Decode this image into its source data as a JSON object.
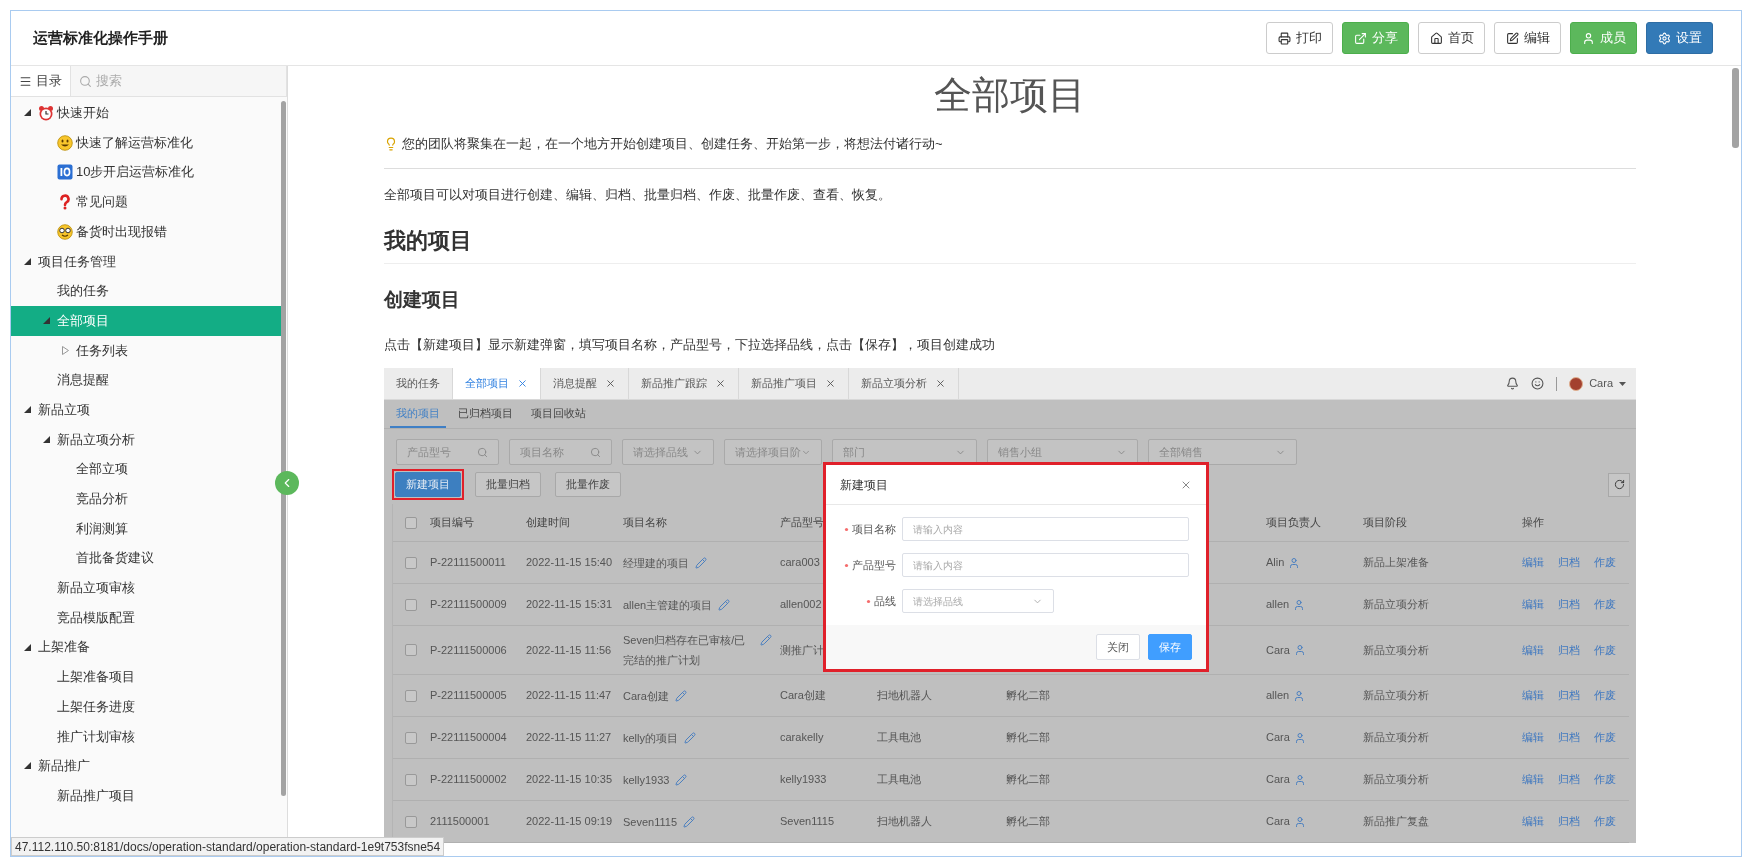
{
  "header": {
    "title": "运营标准化操作手册",
    "buttons": [
      {
        "label": "打印",
        "kind": "default"
      },
      {
        "label": "分享",
        "kind": "success"
      },
      {
        "label": "首页",
        "kind": "default"
      },
      {
        "label": "编辑",
        "kind": "default"
      },
      {
        "label": "成员",
        "kind": "success"
      },
      {
        "label": "设置",
        "kind": "primary"
      }
    ]
  },
  "sidebar": {
    "tabs": [
      {
        "label": "目录",
        "selected": true
      },
      {
        "label": "搜索",
        "selected": false
      }
    ],
    "items": [
      {
        "label": "快速开始",
        "expanded": true,
        "selected": false,
        "children": [
          {
            "label": "快速了解运营标准化",
            "selected": false
          },
          {
            "label": "10步开启运营标准化",
            "selected": false
          },
          {
            "label": "常见问题",
            "selected": false
          },
          {
            "label": "备货时出现报错",
            "selected": false
          }
        ]
      },
      {
        "label": "项目任务管理",
        "expanded": true,
        "selected": false,
        "children": [
          {
            "label": "我的任务",
            "selected": false
          },
          {
            "label": "全部项目",
            "expanded": true,
            "selected": true,
            "children": [
              {
                "label": "任务列表",
                "expanded": false,
                "selected": false
              }
            ]
          },
          {
            "label": "消息提醒",
            "selected": false
          }
        ]
      },
      {
        "label": "新品立项",
        "expanded": true,
        "selected": false,
        "children": [
          {
            "label": "新品立项分析",
            "expanded": true,
            "selected": false,
            "children": [
              {
                "label": "全部立项",
                "selected": false
              },
              {
                "label": "竞品分析",
                "selected": false
              },
              {
                "label": "利润测算",
                "selected": false
              },
              {
                "label": "首批备货建议",
                "selected": false
              }
            ]
          },
          {
            "label": "新品立项审核",
            "selected": false
          },
          {
            "label": "竞品模版配置",
            "selected": false
          }
        ]
      },
      {
        "label": "上架准备",
        "expanded": true,
        "selected": false,
        "children": [
          {
            "label": "上架准备项目",
            "selected": false
          },
          {
            "label": "上架任务进度",
            "selected": false
          },
          {
            "label": "推广计划审核",
            "selected": false
          }
        ]
      },
      {
        "label": "新品推广",
        "expanded": true,
        "selected": false,
        "children": [
          {
            "label": "新品推广项目",
            "selected": false
          }
        ]
      }
    ]
  },
  "document": {
    "title": "全部项目",
    "tip": "您的团队将聚集在一起，在一个地方开始创建项目、创建任务、开始第一步，将想法付诸行动~",
    "intro": "全部项目可以对项目进行创建、编辑、归档、批量归档、作废、批量作废、查看、恢复。",
    "heading": "我的项目",
    "subheading": "创建项目",
    "paragraph": "点击【新建项目】显示新建弹窗，填写项目名称，产品型号，下拉选择品线，点击【保存】，项目创建成功",
    "screenshot": {
      "tabs": [
        {
          "label": "我的任务",
          "selected": false,
          "closable": false
        },
        {
          "label": "全部项目",
          "selected": true,
          "closable": true
        },
        {
          "label": "消息提醒",
          "selected": false,
          "closable": true
        },
        {
          "label": "新品推广跟踪",
          "selected": false,
          "closable": true
        },
        {
          "label": "新品推广项目",
          "selected": false,
          "closable": true
        },
        {
          "label": "新品立项分析",
          "selected": false,
          "closable": true
        }
      ],
      "user": "Cara",
      "subtabs": [
        {
          "label": "我的项目",
          "selected": true
        },
        {
          "label": "已归档项目",
          "selected": false
        },
        {
          "label": "项目回收站",
          "selected": false
        }
      ],
      "filters": [
        {
          "kind": "search",
          "placeholder": "产品型号"
        },
        {
          "kind": "search",
          "placeholder": "项目名称"
        },
        {
          "kind": "select",
          "placeholder": "请选择品线"
        },
        {
          "kind": "select",
          "placeholder": "请选择项目阶"
        },
        {
          "kind": "select",
          "placeholder": "部门"
        },
        {
          "kind": "select",
          "placeholder": "销售小组"
        },
        {
          "kind": "select",
          "placeholder": "全部销售"
        }
      ],
      "buttons": [
        {
          "label": "新建项目",
          "kind": "primary",
          "highlighted": true
        },
        {
          "label": "批量归档",
          "kind": "default",
          "highlighted": false
        },
        {
          "label": "批量作废",
          "kind": "default",
          "highlighted": false
        }
      ],
      "table": {
        "header_checked": false,
        "columns": [
          "项目编号",
          "创建时间",
          "项目名称",
          "产品型号",
          "项目负责人",
          "项目阶段",
          "操作"
        ],
        "rows": [
          {
            "checked": false,
            "id": "P-22111500011",
            "created": "2022-11-15 15:40",
            "name": "经理建的项目",
            "model": "cara003",
            "owner": "Alin",
            "stage": "新品上架准备",
            "actions": [
              "编辑",
              "归档",
              "作废"
            ]
          },
          {
            "checked": false,
            "id": "P-22111500009",
            "created": "2022-11-15 15:31",
            "name": "allen主管建的项目",
            "model": "allen002",
            "owner": "allen",
            "stage": "新品立项分析",
            "actions": [
              "编辑",
              "归档",
              "作废"
            ]
          },
          {
            "checked": false,
            "id": "P-22111500006",
            "created": "2022-11-15 11:56",
            "name": "Seven归档存在已审核/已完结的推广计划",
            "model": "测推广计",
            "owner": "Cara",
            "stage": "新品立项分析",
            "actions": [
              "编辑",
              "归档",
              "作废"
            ]
          },
          {
            "checked": false,
            "id": "P-22111500005",
            "created": "2022-11-15 11:47",
            "name": "Cara创建",
            "model": "Cara创建",
            "column_5": "扫地机器人",
            "column_6": "孵化二部",
            "owner": "allen",
            "stage": "新品立项分析",
            "actions": [
              "编辑",
              "归档",
              "作废"
            ]
          },
          {
            "checked": false,
            "id": "P-22111500004",
            "created": "2022-11-15 11:27",
            "name": "kelly的项目",
            "model": "carakelly",
            "column_5": "工具电池",
            "column_6": "孵化二部",
            "owner": "Cara",
            "stage": "新品立项分析",
            "actions": [
              "编辑",
              "归档",
              "作废"
            ]
          },
          {
            "checked": false,
            "id": "P-22111500002",
            "created": "2022-11-15 10:35",
            "name": "kelly1933",
            "model": "kelly1933",
            "column_5": "工具电池",
            "column_6": "孵化二部",
            "owner": "Cara",
            "stage": "新品立项分析",
            "actions": [
              "编辑",
              "归档",
              "作废"
            ]
          },
          {
            "checked": false,
            "id": "2111500001",
            "created": "2022-11-15 09:19",
            "name": "Seven1115",
            "model": "Seven1115",
            "column_5": "扫地机器人",
            "column_6": "孵化二部",
            "owner": "Cara",
            "stage": "新品推广复盘",
            "actions": [
              "编辑",
              "归档",
              "作废"
            ]
          }
        ]
      },
      "modal": {
        "title": "新建项目",
        "highlighted": true,
        "fields": [
          {
            "label": "项目名称",
            "required": true,
            "kind": "input",
            "placeholder": "请输入内容"
          },
          {
            "label": "产品型号",
            "required": true,
            "kind": "input",
            "placeholder": "请输入内容"
          },
          {
            "label": "品线",
            "required": true,
            "kind": "select",
            "placeholder": "请选择品线"
          }
        ],
        "buttons": [
          {
            "label": "关闭",
            "kind": "default"
          },
          {
            "label": "保存",
            "kind": "primary"
          }
        ]
      }
    }
  },
  "status_url": "47.112.110.50:8181/docs/operation-standard/operation-standard-1e9t753fsne54"
}
